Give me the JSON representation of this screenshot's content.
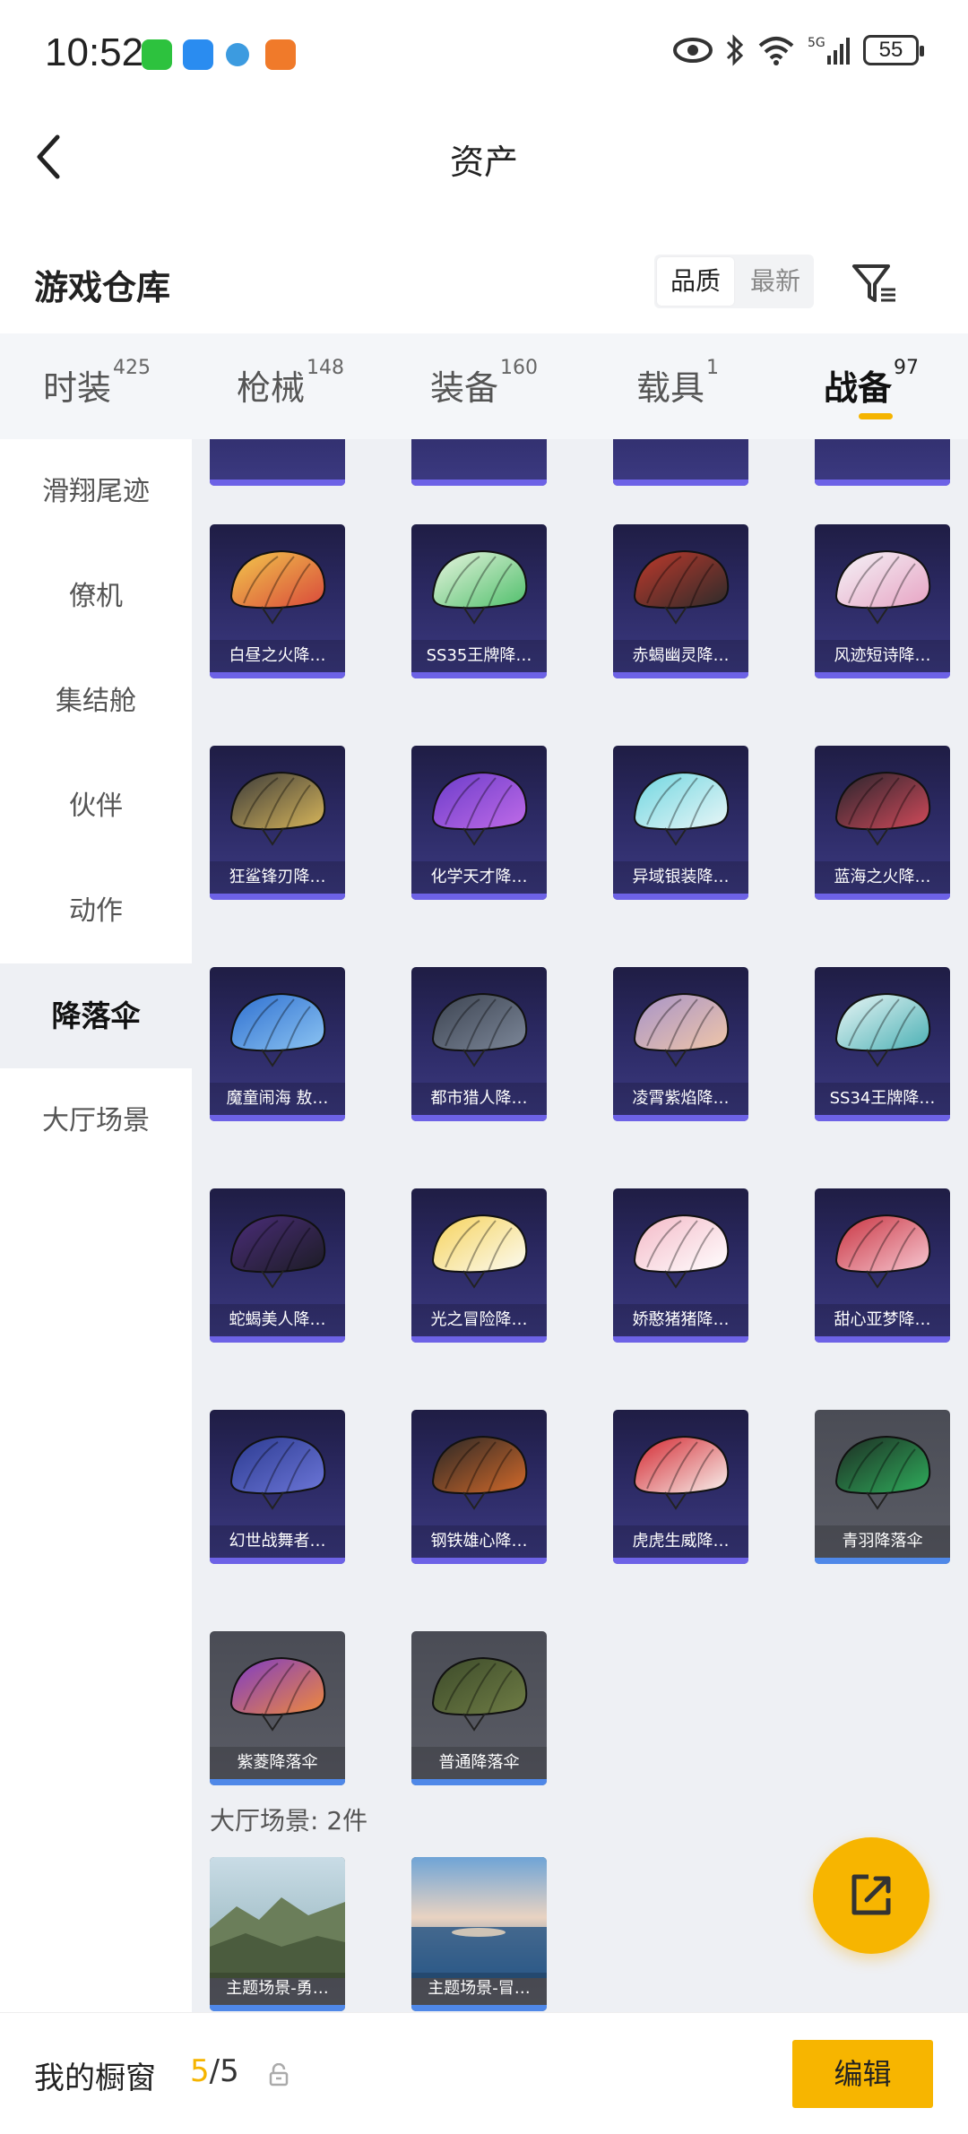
{
  "status_bar": {
    "time": "10:52",
    "battery": "55",
    "network": "5G"
  },
  "nav": {
    "title": "资产"
  },
  "section": {
    "title": "游戏仓库",
    "sort_options": [
      "品质",
      "最新"
    ],
    "active_sort": "品质"
  },
  "tabs": [
    {
      "label": "时装",
      "count": "425"
    },
    {
      "label": "枪械",
      "count": "148"
    },
    {
      "label": "装备",
      "count": "160"
    },
    {
      "label": "载具",
      "count": "1"
    },
    {
      "label": "战备",
      "count": "97"
    }
  ],
  "active_tab": "战备",
  "sidebar": [
    "滑翔尾迹",
    "僚机",
    "集结舱",
    "伙伴",
    "动作",
    "降落伞",
    "大厅场景"
  ],
  "active_sidebar": "降落伞",
  "parachutes": [
    {
      "label": "白昼之火降…",
      "art": "parachute-yellow-red",
      "style": "purple"
    },
    {
      "label": "SS35王牌降…",
      "art": "parachute-green-white",
      "style": "purple"
    },
    {
      "label": "赤蝎幽灵降…",
      "art": "parachute-red-black",
      "style": "purple"
    },
    {
      "label": "风迹短诗降…",
      "art": "parachute-white-pink",
      "style": "purple"
    },
    {
      "label": "狂鲨锋刃降…",
      "art": "parachute-black-gold",
      "style": "purple"
    },
    {
      "label": "化学天才降…",
      "art": "parachute-purple",
      "style": "purple"
    },
    {
      "label": "异域银装降…",
      "art": "parachute-cyan",
      "style": "purple"
    },
    {
      "label": "蓝海之火降…",
      "art": "parachute-dark-red",
      "style": "purple"
    },
    {
      "label": "魔童闹海 敖…",
      "art": "parachute-blue",
      "style": "purple"
    },
    {
      "label": "都市猎人降…",
      "art": "parachute-dark-gray",
      "style": "purple"
    },
    {
      "label": "凌霄紫焰降…",
      "art": "parachute-lilac",
      "style": "purple"
    },
    {
      "label": "SS34王牌降…",
      "art": "parachute-teal-white",
      "style": "purple"
    },
    {
      "label": "蛇蝎美人降…",
      "art": "parachute-purple-black",
      "style": "purple"
    },
    {
      "label": "光之冒险降…",
      "art": "parachute-yellow-white",
      "style": "purple"
    },
    {
      "label": "娇憨猪猪降…",
      "art": "parachute-pink",
      "style": "purple"
    },
    {
      "label": "甜心亚梦降…",
      "art": "parachute-red-pink",
      "style": "purple"
    },
    {
      "label": "幻世战舞者…",
      "art": "parachute-navy",
      "style": "purple"
    },
    {
      "label": "钢铁雄心降…",
      "art": "parachute-black-orange",
      "style": "purple"
    },
    {
      "label": "虎虎生威降…",
      "art": "parachute-red-white",
      "style": "purple"
    },
    {
      "label": "青羽降落伞",
      "art": "parachute-green-black",
      "style": "gray"
    },
    {
      "label": "紫菱降落伞",
      "art": "parachute-purple-orange",
      "style": "gray"
    },
    {
      "label": "普通降落伞",
      "art": "parachute-olive",
      "style": "gray"
    }
  ],
  "lobby_scene": {
    "header": "大厅场景: 2件",
    "items": [
      {
        "label": "主题场景-勇…",
        "art": "scene-mountains"
      },
      {
        "label": "主题场景-冒…",
        "art": "scene-sea-sky"
      }
    ]
  },
  "showcase": {
    "label": "我的橱窗",
    "current": "5",
    "total": "/5"
  },
  "edit_button": "编辑",
  "colors": {
    "accent": "#f7b500",
    "card_purple": "#2a2860",
    "card_gray": "#565862",
    "rarity_bar": "#6d62e6"
  }
}
